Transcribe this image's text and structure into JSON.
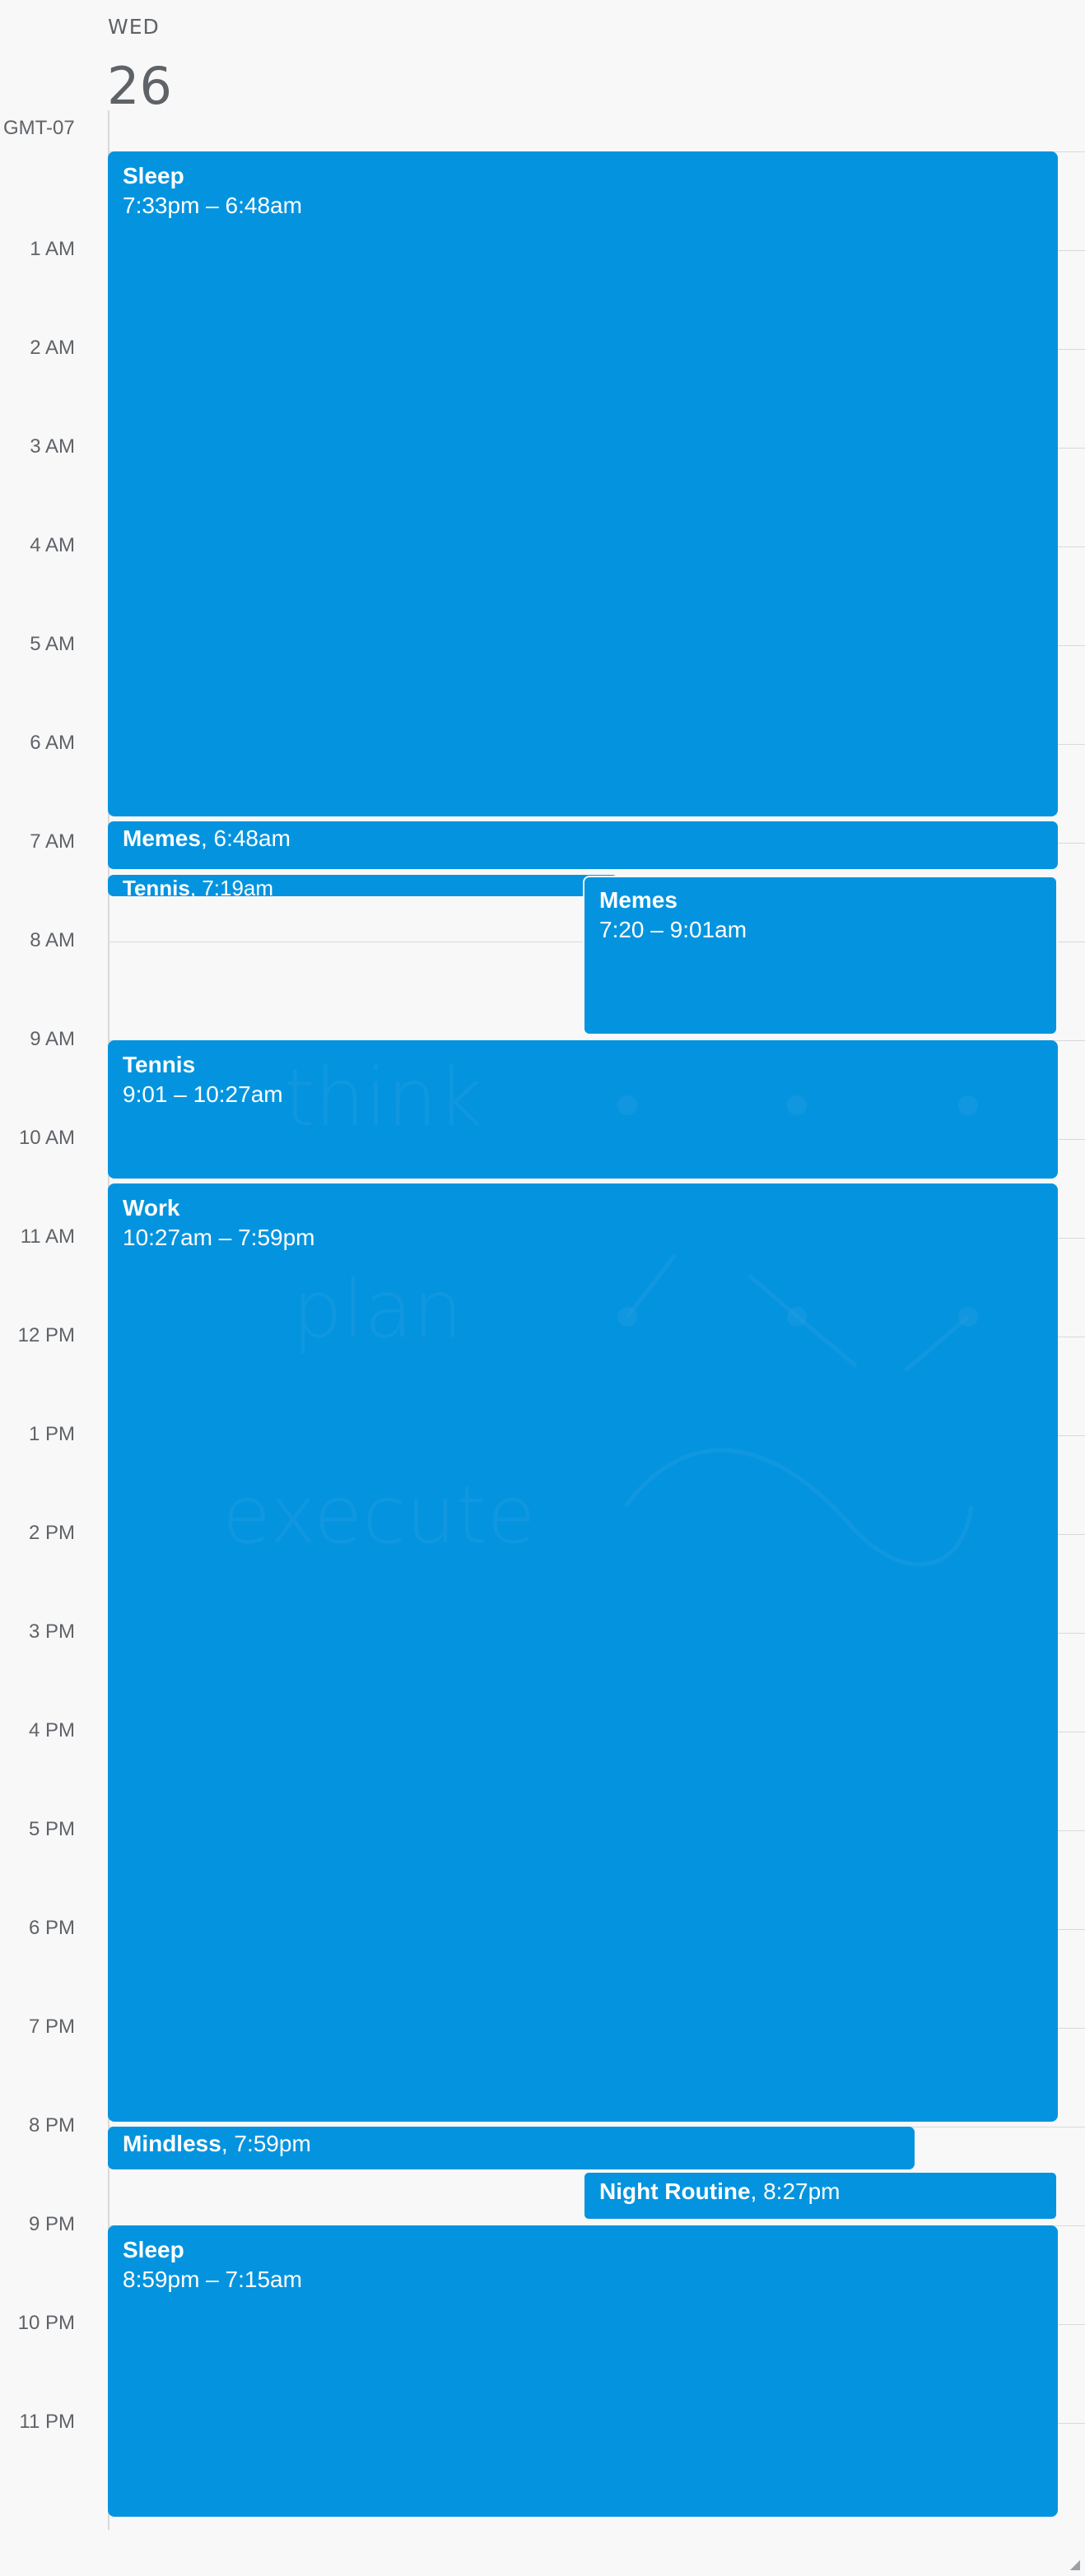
{
  "header": {
    "day_name": "WED",
    "day_number": "26",
    "timezone": "GMT-07"
  },
  "hours": [
    "1 AM",
    "2 AM",
    "3 AM",
    "4 AM",
    "5 AM",
    "6 AM",
    "7 AM",
    "8 AM",
    "9 AM",
    "10 AM",
    "11 AM",
    "12 PM",
    "1 PM",
    "2 PM",
    "3 PM",
    "4 PM",
    "5 PM",
    "6 PM",
    "7 PM",
    "8 PM",
    "9 PM",
    "10 PM",
    "11 PM"
  ],
  "events": [
    {
      "title": "Sleep",
      "time": "7:33pm – 6:48am"
    },
    {
      "title": "Memes",
      "time": "6:48am"
    },
    {
      "title": "Tennis",
      "time": "7:19am"
    },
    {
      "title": "Memes",
      "time": "7:20 – 9:01am"
    },
    {
      "title": "Tennis",
      "time": "9:01 – 10:27am"
    },
    {
      "title": "Work",
      "time": "10:27am – 7:59pm"
    },
    {
      "title": "Mindless",
      "time": "7:59pm"
    },
    {
      "title": "Night Routine",
      "time": "8:27pm"
    },
    {
      "title": "Sleep",
      "time": "8:59pm – 7:15am"
    }
  ],
  "watermark": {
    "word1": "think",
    "word2": "plan",
    "word3": "execute"
  },
  "colors": {
    "event_bg": "#0494df",
    "event_text": "#ffffff",
    "background": "#f8f8f8",
    "grid": "#d9d9d9",
    "label": "#5f6368"
  }
}
